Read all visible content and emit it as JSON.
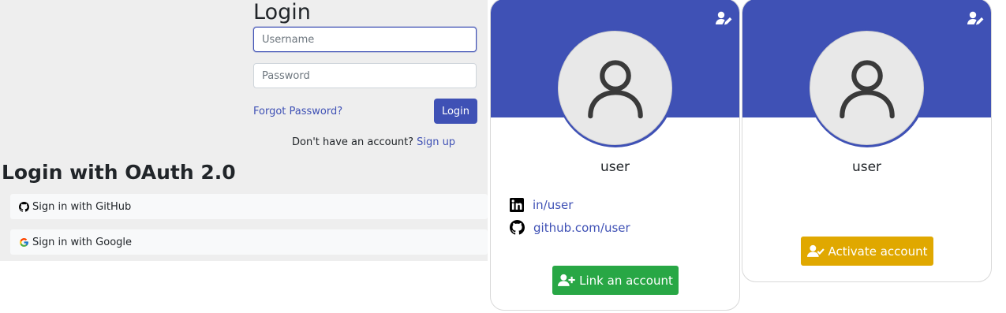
{
  "login": {
    "title": "Login",
    "username_placeholder": "Username",
    "password_placeholder": "Password",
    "forgot_password": "Forgot Password?",
    "login_button": "Login",
    "no_account_text": "Don't have an account?",
    "signup_link": "Sign up"
  },
  "oauth": {
    "title": "Login with OAuth 2.0",
    "github_button": "Sign in with GitHub",
    "google_button": "Sign in with Google"
  },
  "cards": [
    {
      "username": "user",
      "linkedin": "in/user",
      "github": "github.com/user",
      "action_button": "Link an account",
      "action_color": "#28a745",
      "edit_icon": "user-edit-icon"
    },
    {
      "username": "user",
      "action_button": "Activate account",
      "action_color": "#e0a800",
      "edit_icon": "user-edit-icon"
    }
  ],
  "colors": {
    "primary": "#3f51b5",
    "success": "#28a745",
    "warning": "#e0a800",
    "login_bg": "#eeeeee"
  }
}
